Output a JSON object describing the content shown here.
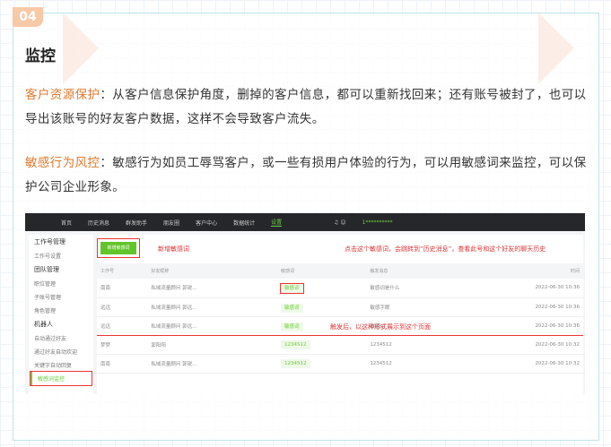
{
  "badge": "04",
  "title": "监控",
  "para1": {
    "label": "客户资源保护",
    "text": "：从客户信息保护角度，删掉的客户信息，都可以重新找回来；还有账号被封了，也可以导出该账号的好友客户数据，这样不会导致客户流失。"
  },
  "para2": {
    "label": "敏感行为风控",
    "text": "：敏感行为如员工辱骂客户，或一些有损用户体验的行为，可以用敏感词来监控，可以保护公司企业形象。"
  },
  "nav": [
    "首页",
    "历史消息",
    "群发助手",
    "朋友圈",
    "客户中心",
    "数据统计",
    "设置"
  ],
  "user": "1**********",
  "sidebar": [
    "工作号管理",
    "工作号设置",
    "团队管理",
    "职位管理",
    "子账号管理",
    "角色管理",
    "机器人",
    "自动通过好友",
    "通过好友自动欢迎",
    "关键字自动回复",
    "敏感词监控"
  ],
  "add_button": "新增敏感词",
  "annotations": {
    "add": "新增敏感词",
    "click": "点击这个敏感词，会跳转到“历史消息”，查看此号和这个好友的聊天历史",
    "trigger": "触发后，以这种形式展示到这个页面"
  },
  "table": {
    "headers": [
      "工作号",
      "好友昵称",
      "敏感词",
      "触发消息",
      "时间"
    ],
    "rows": [
      [
        "南南",
        "私域流量顾问 郭锐...",
        "敏感词",
        "敏感词是什么",
        "2022-06-30 10:36"
      ],
      [
        "远远",
        "私域流量顾问 郭远...",
        "敏感词",
        "敏感字眼",
        "2022-06-30 10:36"
      ],
      [
        "远远",
        "私域流量顾问 郭远...",
        "敏感词",
        "敏感词",
        "2022-06-30 10:36"
      ],
      [
        "梦梦",
        "郭阳阳",
        "1234512",
        "1234512",
        "2022-06-30 10:32"
      ],
      [
        "南南",
        "私域流量顾问 郭锐...",
        "1234512",
        "1234512",
        "2022-06-30 10:32"
      ]
    ]
  }
}
